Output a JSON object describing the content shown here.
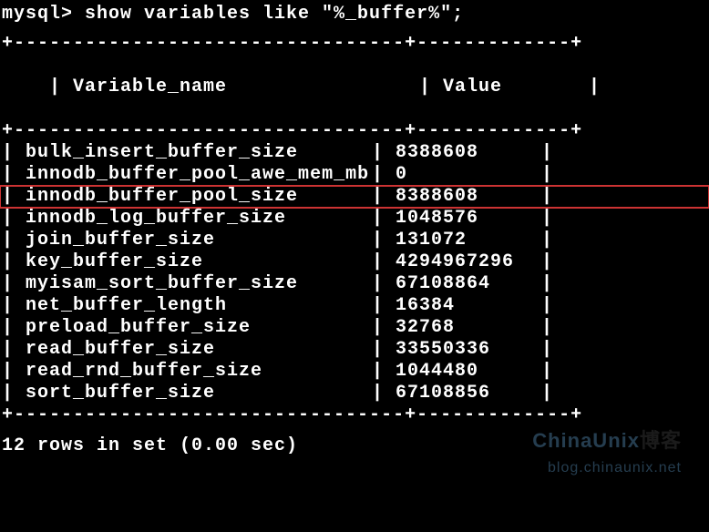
{
  "prompt": "mysql> show variables like  \"%_buffer%\";",
  "header": {
    "col1": "Variable_name",
    "col2": "Value"
  },
  "rows": [
    {
      "name": "bulk_insert_buffer_size",
      "value": "8388608",
      "highlighted": false
    },
    {
      "name": "innodb_buffer_pool_awe_mem_mb",
      "value": "0",
      "highlighted": false
    },
    {
      "name": "innodb_buffer_pool_size",
      "value": "8388608",
      "highlighted": true
    },
    {
      "name": "innodb_log_buffer_size",
      "value": "1048576",
      "highlighted": false
    },
    {
      "name": "join_buffer_size",
      "value": "131072",
      "highlighted": false
    },
    {
      "name": "key_buffer_size",
      "value": "4294967296",
      "highlighted": false
    },
    {
      "name": "myisam_sort_buffer_size",
      "value": "67108864",
      "highlighted": false
    },
    {
      "name": "net_buffer_length",
      "value": "16384",
      "highlighted": false
    },
    {
      "name": "preload_buffer_size",
      "value": "32768",
      "highlighted": false
    },
    {
      "name": "read_buffer_size",
      "value": "33550336",
      "highlighted": false
    },
    {
      "name": "read_rnd_buffer_size",
      "value": "1044480",
      "highlighted": false
    },
    {
      "name": "sort_buffer_size",
      "value": "67108856",
      "highlighted": false
    }
  ],
  "footer": "12 rows in set (0.00 sec)",
  "watermark": {
    "main": "ChinaUnix",
    "cn": "博客",
    "sub": "blog.chinaunix.net"
  },
  "chart_data": {
    "type": "table",
    "title": "MySQL buffer variables",
    "columns": [
      "Variable_name",
      "Value"
    ],
    "rows": [
      [
        "bulk_insert_buffer_size",
        8388608
      ],
      [
        "innodb_buffer_pool_awe_mem_mb",
        0
      ],
      [
        "innodb_buffer_pool_size",
        8388608
      ],
      [
        "innodb_log_buffer_size",
        1048576
      ],
      [
        "join_buffer_size",
        131072
      ],
      [
        "key_buffer_size",
        4294967296
      ],
      [
        "myisam_sort_buffer_size",
        67108864
      ],
      [
        "net_buffer_length",
        16384
      ],
      [
        "preload_buffer_size",
        32768
      ],
      [
        "read_buffer_size",
        33550336
      ],
      [
        "read_rnd_buffer_size",
        1044480
      ],
      [
        "sort_buffer_size",
        67108856
      ]
    ]
  }
}
